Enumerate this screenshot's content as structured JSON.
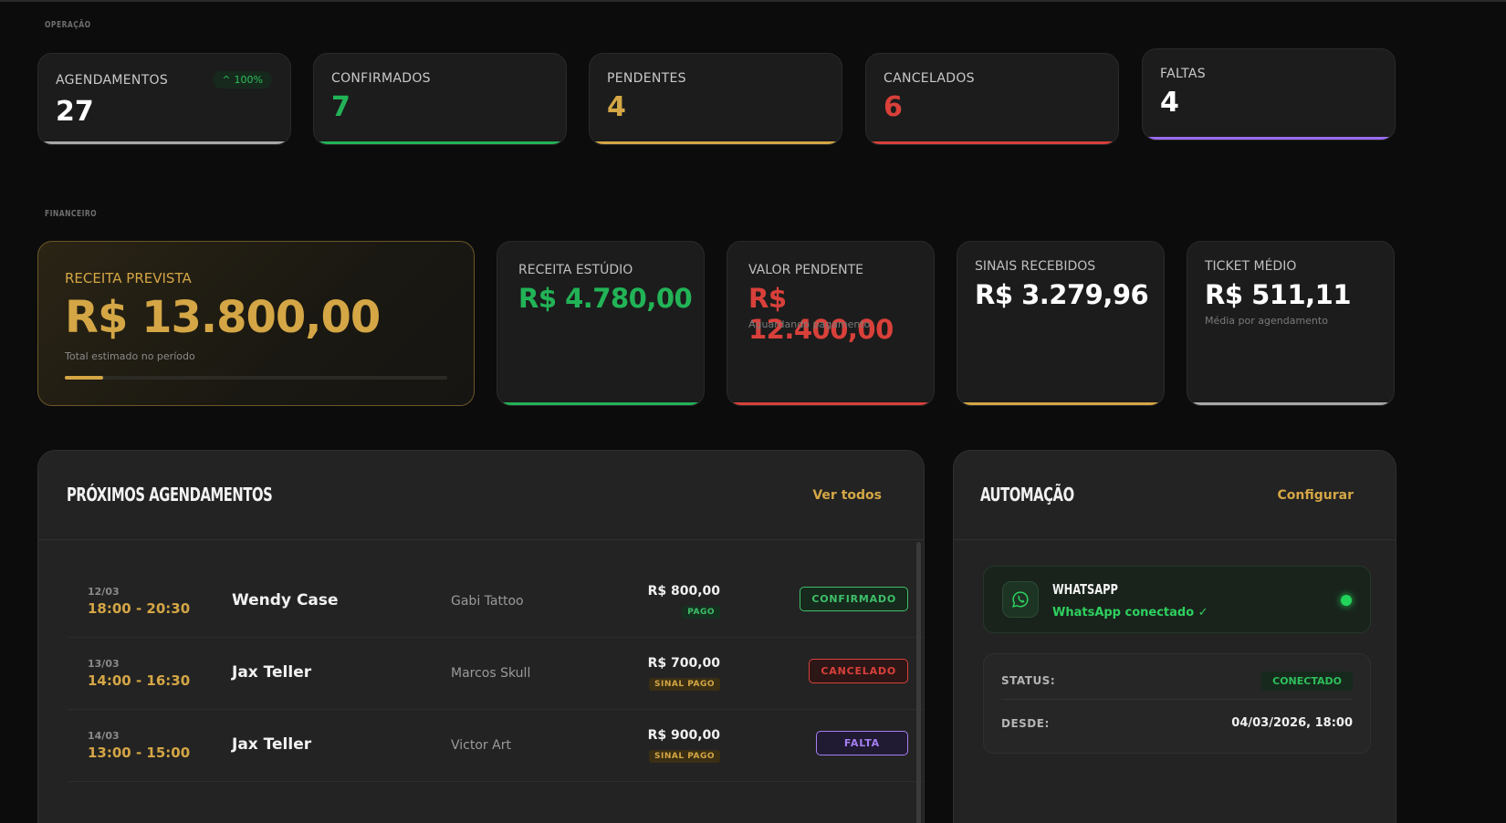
{
  "sections": {
    "operacao": "OPERAÇÃO",
    "financeiro": "FINANCEIRO"
  },
  "operacao": {
    "agendamentos": {
      "label": "AGENDAMENTOS",
      "value": "27",
      "trend": "100%"
    },
    "confirmados": {
      "label": "CONFIRMADOS",
      "value": "7"
    },
    "pendentes": {
      "label": "PENDENTES",
      "value": "4"
    },
    "cancelados": {
      "label": "CANCELADOS",
      "value": "6"
    },
    "faltas": {
      "label": "FALTAS",
      "value": "4"
    }
  },
  "financeiro": {
    "receita_prevista": {
      "label": "RECEITA PREVISTA",
      "value": "R$ 13.800,00",
      "sub": "Total estimado no período",
      "progress": 0.1
    },
    "receita_estudio": {
      "label": "RECEITA ESTÚDIO",
      "value": "R$ 4.780,00"
    },
    "valor_pendente": {
      "label": "VALOR PENDENTE",
      "value": "R$ 12.400,00",
      "sub": "Aguardando pagamento"
    },
    "sinais_recebidos": {
      "label": "SINAIS RECEBIDOS",
      "value": "R$ 3.279,96"
    },
    "ticket_medio": {
      "label": "TICKET MÉDIO",
      "value": "R$ 511,11",
      "sub": "Média por agendamento"
    }
  },
  "agendamentos": {
    "title": "PRÓXIMOS AGENDAMENTOS",
    "link": "Ver todos",
    "rows": [
      {
        "date": "12/03",
        "time": "18:00 - 20:30",
        "client": "Wendy Case",
        "artist": "Gabi Tattoo",
        "price": "R$ 800,00",
        "payment": "PAGO",
        "status": "CONFIRMADO"
      },
      {
        "date": "13/03",
        "time": "14:00 - 16:30",
        "client": "Jax Teller",
        "artist": "Marcos Skull",
        "price": "R$ 700,00",
        "payment": "SINAL PAGO",
        "status": "CANCELADO"
      },
      {
        "date": "14/03",
        "time": "13:00 - 15:00",
        "client": "Jax Teller",
        "artist": "Victor Art",
        "price": "R$ 900,00",
        "payment": "SINAL PAGO",
        "status": "FALTA"
      }
    ]
  },
  "automacao": {
    "title": "AUTOMAÇÃO",
    "link": "Configurar",
    "whatsapp": {
      "title": "WHATSAPP",
      "sub": "WhatsApp conectado ✓"
    },
    "status_label": "STATUS:",
    "status_value": "CONECTADO",
    "desde_label": "DESDE:",
    "desde_value": "04/03/2026, 18:00"
  },
  "colors": {
    "green": "#22b357",
    "yellow": "#d4a645",
    "red": "#d9403a",
    "purple": "#9b6bf0",
    "gray": "#a8a8a8"
  }
}
